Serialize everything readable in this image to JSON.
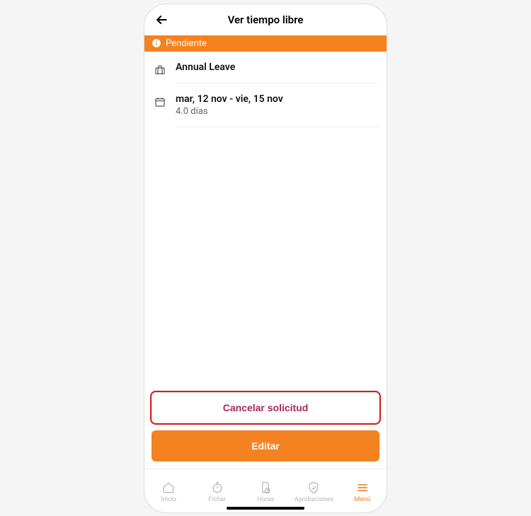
{
  "header": {
    "title": "Ver tiempo libre"
  },
  "status": {
    "label": "Pendiente"
  },
  "leave": {
    "type": "Annual Leave",
    "date_range": "mar, 12 nov - vie, 15 nov",
    "duration": "4.0 días"
  },
  "actions": {
    "cancel": "Cancelar solicitud",
    "edit": "Editar"
  },
  "tabs": {
    "home": "Inicio",
    "clock": "Fichar",
    "hours": "Horas",
    "approvals": "Aprobaciones",
    "menu": "Menú"
  }
}
